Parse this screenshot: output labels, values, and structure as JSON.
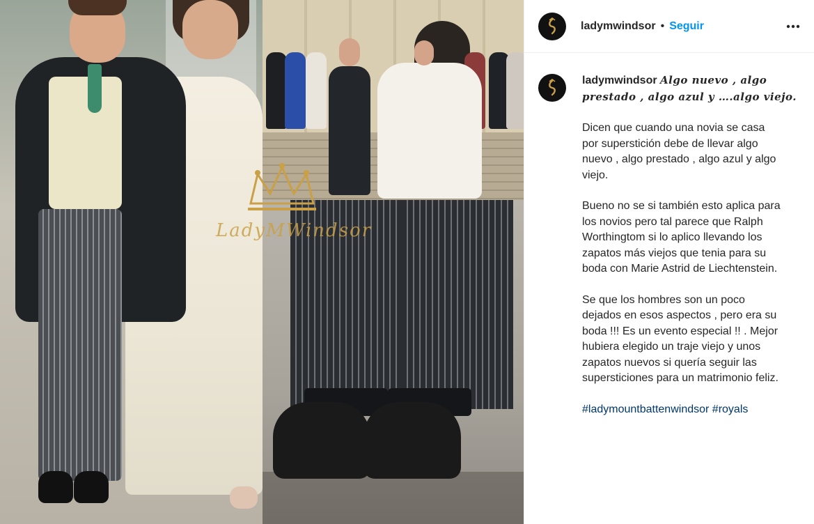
{
  "post": {
    "username": "ladymwindsor",
    "separator": "•",
    "follow_label": "Seguir",
    "more_icon": "more-horizontal-icon",
    "avatar_icon": "gold-crest-icon"
  },
  "caption": {
    "username": "ladymwindsor",
    "title": "Algo nuevo , algo prestado , algo azul y ….algo viejo.",
    "paragraphs": [
      "Dicen que cuando una novia se casa\npor superstición  debe de llevar algo\nnuevo , algo prestado , algo azul y algo\nviejo.",
      "Bueno no se si también esto aplica para\nlos novios  pero  tal parece que Ralph\nWorthingtom si lo aplico llevando los\nzapatos más viejos que tenia para su\nboda con Marie Astrid de Liechtenstein.",
      "Se que los hombres son un poco\ndejados en esos aspectos , pero era su\nboda !!! Es un evento especial !! . Mejor\nhubiera elegido un traje viejo y unos\nzapatos nuevos si quería seguir las\nsupersticiones para un matrimonio feliz."
    ],
    "hashtags": [
      "#ladymountbattenwindsor",
      "#royals"
    ]
  },
  "media": {
    "watermark": "LadyMWindsor",
    "colors": {
      "watermark_gold": "#c9a048",
      "link_blue": "#0095f6",
      "hashtag_blue": "#00376b"
    }
  }
}
